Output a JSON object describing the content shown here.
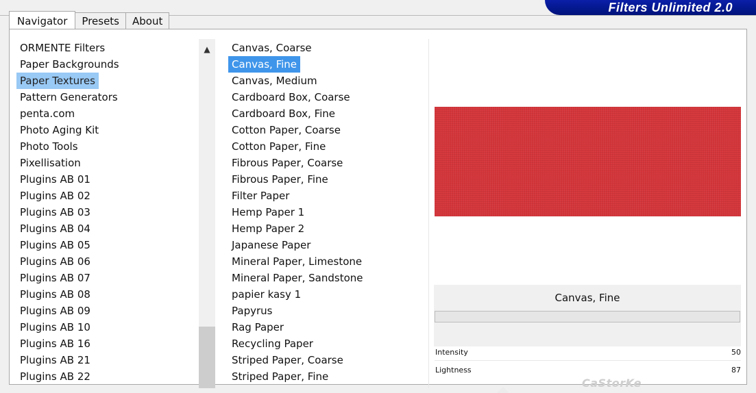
{
  "brand": {
    "title": "Filters Unlimited 2.0"
  },
  "tabs": [
    {
      "label": "Navigator",
      "active": true
    },
    {
      "label": "Presets",
      "active": false
    },
    {
      "label": "About",
      "active": false
    }
  ],
  "categories": {
    "items": [
      "ORMENTE Filters",
      "Paper Backgrounds",
      "Paper Textures",
      "Pattern Generators",
      "penta.com",
      "Photo Aging Kit",
      "Photo Tools",
      "Pixellisation",
      "Plugins AB 01",
      "Plugins AB 02",
      "Plugins AB 03",
      "Plugins AB 04",
      "Plugins AB 05",
      "Plugins AB 06",
      "Plugins AB 07",
      "Plugins AB 08",
      "Plugins AB 09",
      "Plugins AB 10",
      "Plugins AB 16",
      "Plugins AB 21",
      "Plugins AB 22"
    ],
    "selected_index": 2
  },
  "filters": {
    "items": [
      "Canvas, Coarse",
      "Canvas, Fine",
      "Canvas, Medium",
      "Cardboard Box, Coarse",
      "Cardboard Box, Fine",
      "Cotton Paper, Coarse",
      "Cotton Paper, Fine",
      "Fibrous Paper, Coarse",
      "Fibrous Paper, Fine",
      "Filter Paper",
      "Hemp Paper 1",
      "Hemp Paper 2",
      "Japanese Paper",
      "Mineral Paper, Limestone",
      "Mineral Paper, Sandstone",
      "papier kasy 1",
      "Papyrus",
      "Rag Paper",
      "Recycling Paper",
      "Striped Paper, Coarse",
      "Striped Paper, Fine"
    ],
    "selected_index": 1
  },
  "preview": {
    "filter_name": "Canvas, Fine",
    "color": "#d4353a"
  },
  "params": [
    {
      "label": "Intensity",
      "value": "50"
    },
    {
      "label": "Lightness",
      "value": "87"
    }
  ],
  "watermark": "CaStorKe",
  "colors": {
    "brand": "#00127a",
    "cat_selected": "#99c9f5",
    "filter_selected": "#3f95ea"
  },
  "icons": {
    "scroll_up": "chevron-up-icon"
  }
}
